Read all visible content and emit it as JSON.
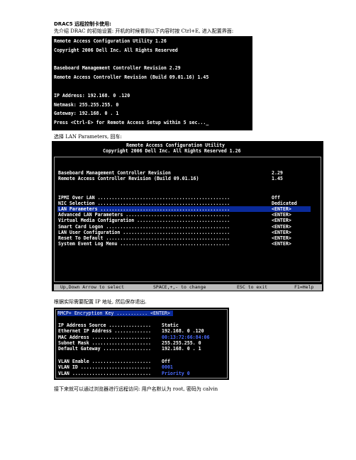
{
  "doc": {
    "title": "DRAC5 远程控制卡使用:",
    "intro": "先介绍 DRAC 的初始设置: 开机的时候看到以下内容时按 Ctrl+E, 进入配置界面:",
    "step_lan": "选择 LAN Parameters, 回车:",
    "step_ip": "根据实际需要配置 IP 地址, 然后保存退出.",
    "step_web": "接下来就可以通过浏览器进行远程访问: 用户名默认为 root, 密码为 calvin"
  },
  "boot_screen": {
    "lines": [
      "Remote Access Configuration Utility 1.26",
      "Copyright 2006 Dell Inc. All Rights Reserved",
      "",
      "Baseboard Management Controller Revision 2.29",
      "Remote Access Controller Revision (Build 09.01.16) 1.45",
      "",
      "IP Address: 192.168. 0 .120",
      "Netmask: 255.255.255. 0",
      "Gateway: 192.168. 0 . 1",
      "Press <Ctrl-E> for Remote Access Setup within 5 sec..._"
    ]
  },
  "utility_screen": {
    "header_title": "Remote Access Configuration Utility",
    "header_copyright": "Copyright 2006 Dell Inc. All Rights Reserved 1.26",
    "revisions": [
      {
        "label": "Baseboard Management Controller Revision",
        "value": "2.29"
      },
      {
        "label": "Remote Access Controller Revision (Build 09.01.16)",
        "value": "1.45"
      }
    ],
    "menu": [
      {
        "label": "IPMI Over LAN ...............................................",
        "value": "Off"
      },
      {
        "label": "NIC Selection ...............................................",
        "value": "Dedicated"
      },
      {
        "label": "LAN Parameters ..............................................",
        "value": "<ENTER>",
        "selected": true
      },
      {
        "label": "Advanced LAN Parameters .....................................",
        "value": "<ENTER>"
      },
      {
        "label": "Virtual Media Configuration .................................",
        "value": "<ENTER>"
      },
      {
        "label": "Smart Card Logon ............................................",
        "value": "<ENTER>"
      },
      {
        "label": "LAN User Configuration ......................................",
        "value": "<ENTER>"
      },
      {
        "label": "Reset To Default ............................................",
        "value": "<ENTER>"
      },
      {
        "label": "System Event Log Menu .......................................",
        "value": "<ENTER>"
      }
    ],
    "footer": {
      "nav": "Up,Down Arrow to select",
      "change": "SPACE,+,- to change",
      "exit": "ESC to exit",
      "help": "F1=Help"
    }
  },
  "lan_screen": {
    "top_item": {
      "label": "RMCP+ Encryption Key ...........",
      "value": "<ENTER>"
    },
    "fields": [
      {
        "label": "IP Address Source ...............",
        "value": "Static"
      },
      {
        "label": "Ethernet IP Address .............",
        "value": "192.168. 0 .120"
      },
      {
        "label": "MAC Address .....................",
        "value": "00:13:72:66:84:06"
      },
      {
        "label": "Subnet Mask .....................",
        "value": "255.255.255. 0"
      },
      {
        "label": "Default Gateway .................",
        "value": "192.168. 0 . 1"
      }
    ],
    "vlan": [
      {
        "label": "VLAN Enable .....................",
        "value": "Off"
      },
      {
        "label": "VLAN ID .........................",
        "value": "0001"
      },
      {
        "label": "VLAN ............................",
        "value": "Priority 0"
      }
    ]
  },
  "colors": {
    "screen_bg": "#000000",
    "selection": "#0a2a9a",
    "status_bar": "#bdbdbd",
    "value_blue": "#4a6cff"
  }
}
